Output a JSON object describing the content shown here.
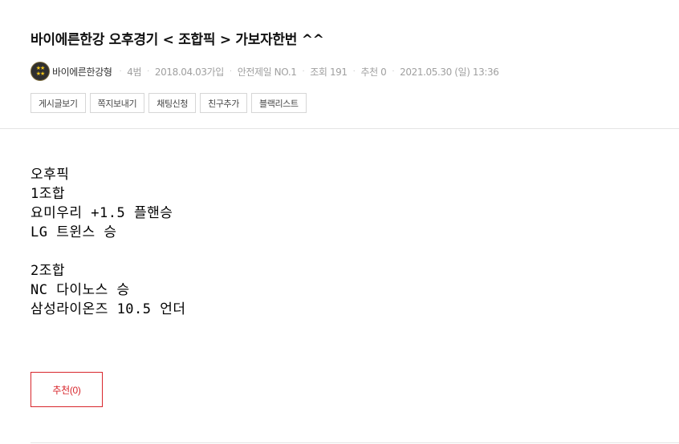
{
  "post": {
    "title": "바이에른한강 오후경기 < 조합픽 > 가보자한번 ^^"
  },
  "meta": {
    "author": "바이에른한강형",
    "level": "4범",
    "joined": "2018.04.03가입",
    "badge": "안전제일 NO.1",
    "views": "조회 191",
    "recommends": "추천 0",
    "datetime": "2021.05.30 (일) 13:36",
    "avatar_icon": "star-emblem-icon"
  },
  "actions": [
    "게시글보기",
    "쪽지보내기",
    "채팅신청",
    "친구추가",
    "블랙리스트"
  ],
  "content": {
    "lines": [
      "오후픽",
      "1조합",
      "요미우리 +1.5 플핸승",
      "LG 트윈스 승",
      "",
      "2조합",
      "NC 다이노스 승",
      "삼성라이온즈 10.5 언더"
    ]
  },
  "recommend_button": {
    "label": "추천(0)"
  },
  "colors": {
    "accent": "#d8262c",
    "meta_text": "#a0a0a0",
    "border": "#d6d6d6"
  }
}
